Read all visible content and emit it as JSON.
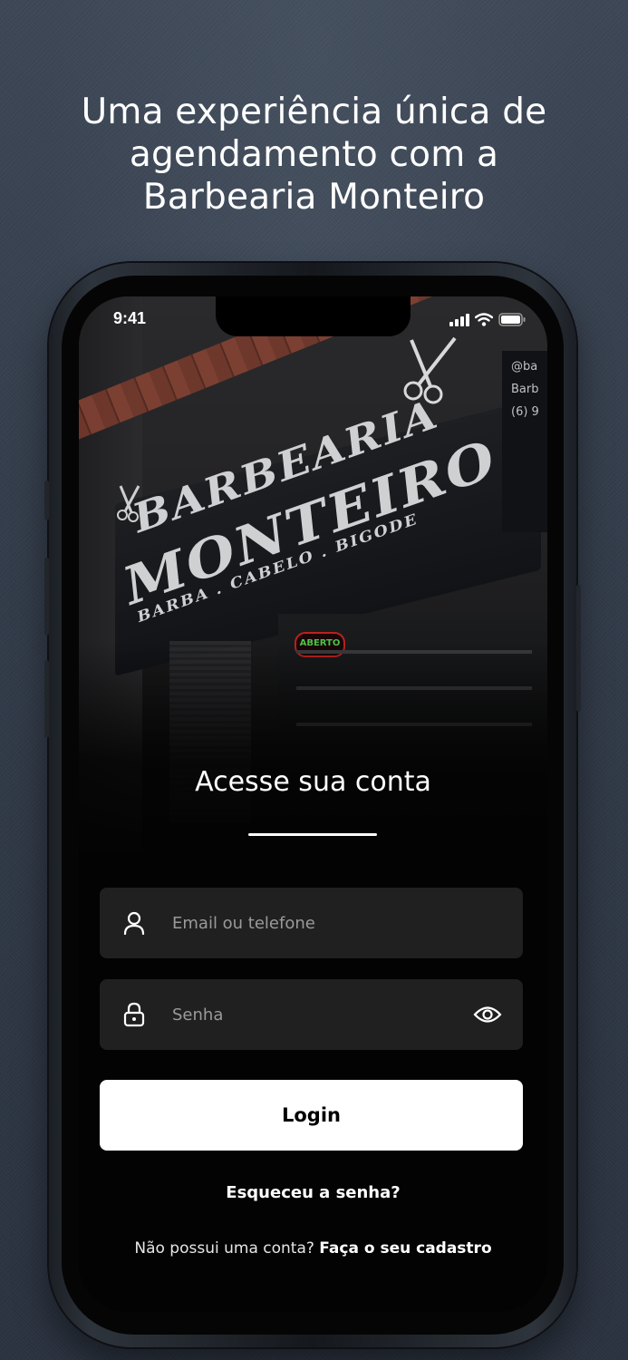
{
  "headline": {
    "line1": "Uma experiência única de",
    "line2": "agendamento com a",
    "line3": "Barbearia Monteiro"
  },
  "status_bar": {
    "time": "9:41"
  },
  "photo": {
    "sign_line1": "BARBEARIA",
    "sign_line2": "MONTEIRO",
    "sign_line3": "BARBA . CABELO . BIGODE",
    "open_sign": "ABERTO",
    "social_handles": [
      "@ba",
      "Barb",
      "(6) 9"
    ]
  },
  "login": {
    "title": "Acesse sua conta",
    "email_placeholder": "Email ou telefone",
    "password_placeholder": "Senha",
    "login_button": "Login",
    "forgot_password": "Esqueceu a senha?",
    "no_account_text": "Não possui uma conta?",
    "signup_link": "Faça o seu cadastro"
  },
  "icons": {
    "email_field": "user-icon",
    "password_field": "lock-icon",
    "toggle_password": "eye-icon"
  },
  "colors": {
    "background": "#323b49",
    "field_background": "#202020",
    "button_background": "#ffffff",
    "button_text": "#000000",
    "open_sign_border": "#b8231f",
    "open_sign_text": "#4cc44c"
  }
}
